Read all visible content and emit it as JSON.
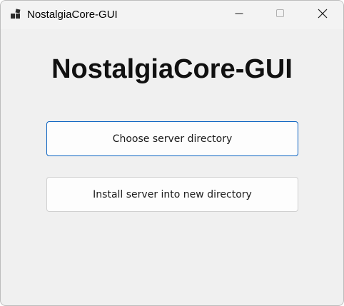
{
  "window": {
    "title": "NostalgiaCore-GUI"
  },
  "titlebar": {
    "app_icon": "app-icon",
    "minimize_icon": "minimize-icon",
    "maximize_icon": "maximize-icon",
    "close_icon": "close-icon"
  },
  "main": {
    "heading": "NostalgiaCore-GUI",
    "choose_button_label": "Choose server directory",
    "install_button_label": "Install server into new directory"
  },
  "colors": {
    "window_background": "#f0f0f0",
    "titlebar_background": "#f3f3f3",
    "focus_border": "#0a62c1",
    "button_background": "#fdfdfd"
  }
}
